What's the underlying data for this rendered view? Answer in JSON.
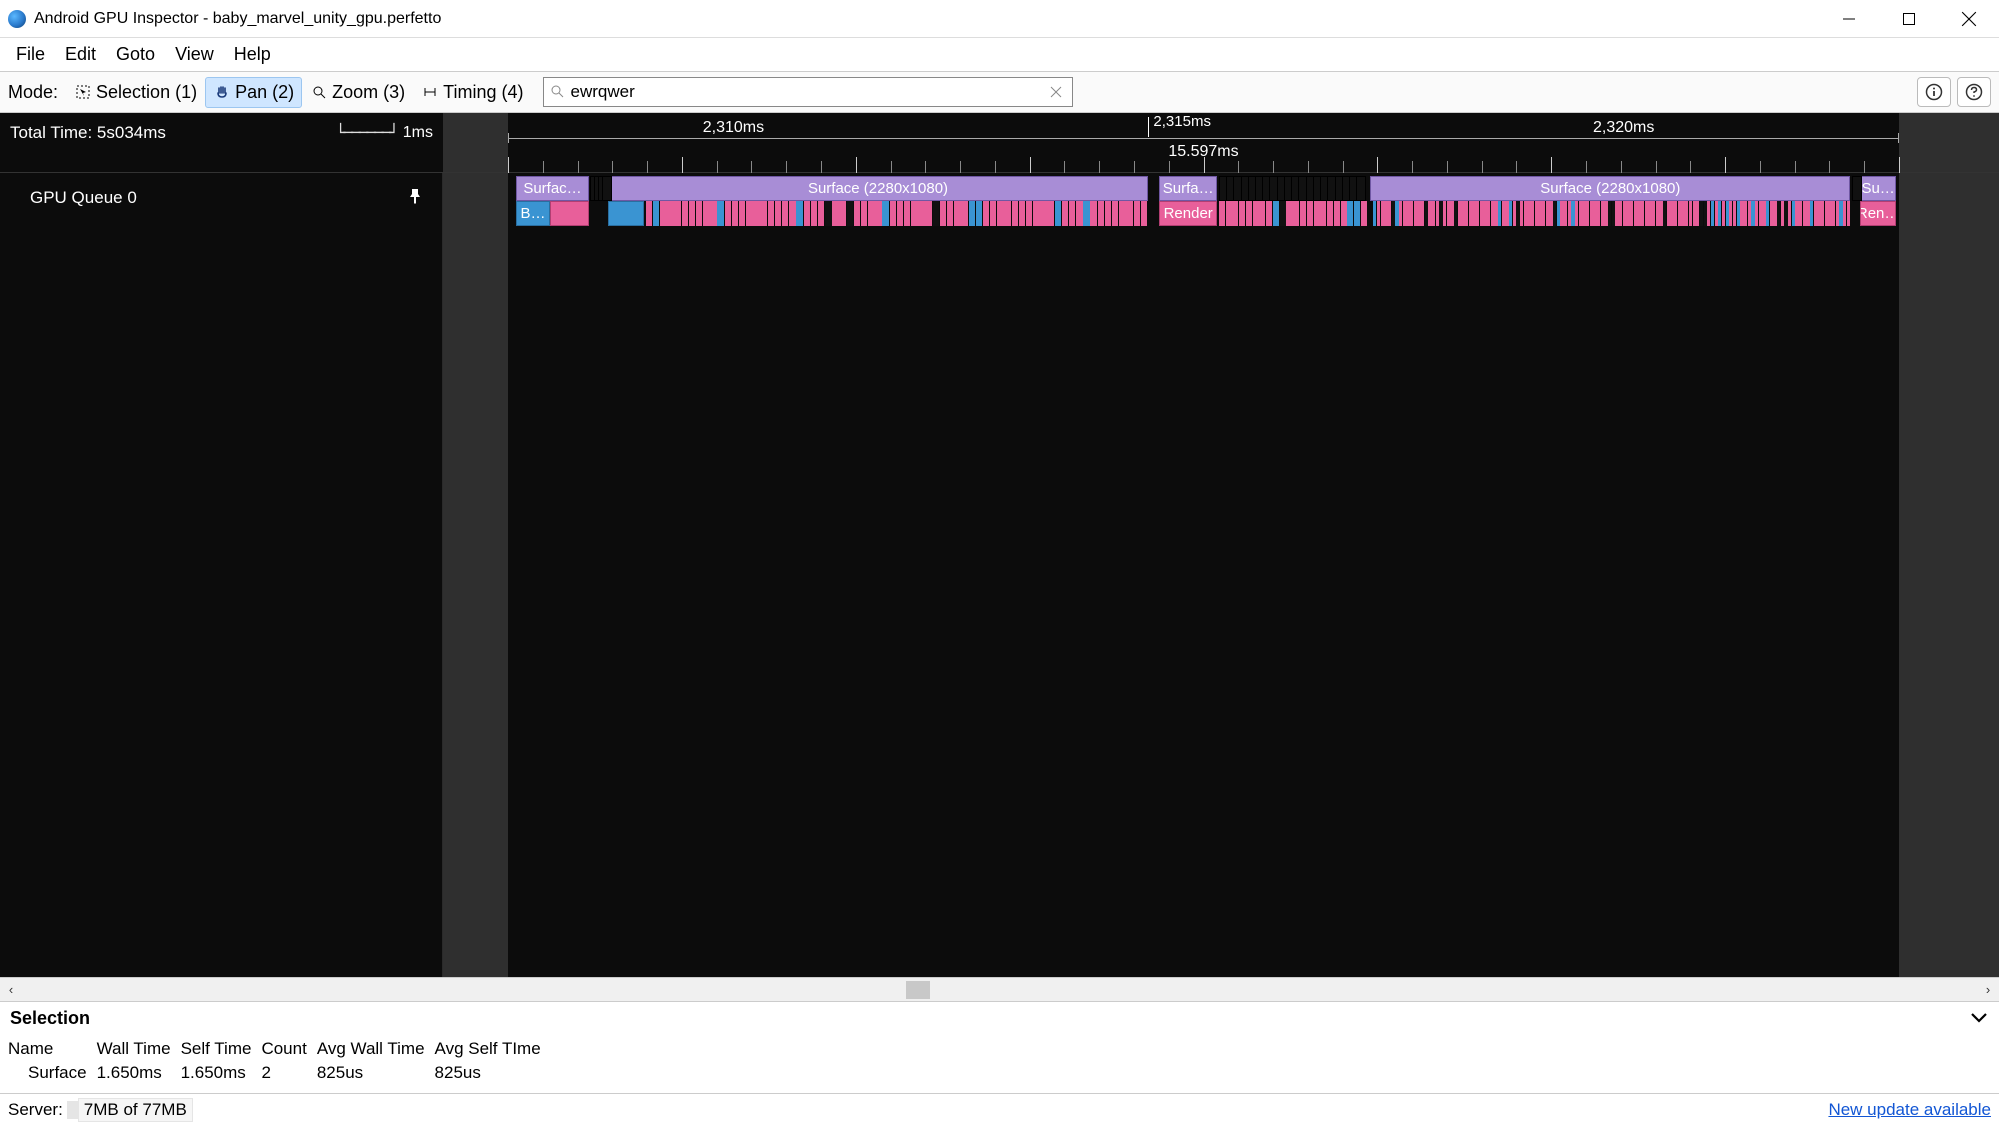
{
  "window": {
    "title": "Android GPU Inspector - baby_marvel_unity_gpu.perfetto"
  },
  "menu": {
    "items": [
      "File",
      "Edit",
      "Goto",
      "View",
      "Help"
    ]
  },
  "toolbar": {
    "mode_label": "Mode:",
    "modes": {
      "selection": "Selection (1)",
      "pan": "Pan (2)",
      "zoom": "Zoom (3)",
      "timing": "Timing (4)"
    },
    "active_mode": "pan",
    "search_value": "ewrqwer"
  },
  "timeline": {
    "total_time_label": "Total Time: 5s034ms",
    "scale_label": "1ms",
    "ruler_labels": {
      "t0": "2,310ms",
      "t1": "2,315ms",
      "t2": "2,320ms"
    },
    "range_span_label": "15.597ms"
  },
  "tracks": {
    "gpu_queue_label": "GPU Queue 0",
    "slices": {
      "surface_short": "Surfac…",
      "surface_trunc2": "Surfa…",
      "surface_tiny": "Su…",
      "surface_full": "Surface (2280x1080)",
      "b_short": "B…",
      "render": "Render",
      "render_short": "Ren…"
    }
  },
  "selection": {
    "heading": "Selection",
    "columns": [
      "Name",
      "Wall Time",
      "Self Time",
      "Count",
      "Avg Wall Time",
      "Avg Self TIme"
    ],
    "rows": [
      {
        "name": "Surface",
        "wall": "1.650ms",
        "self": "1.650ms",
        "count": "2",
        "avg_wall": "825us",
        "avg_self": "825us"
      }
    ]
  },
  "status": {
    "server_label": "Server:",
    "memory": "7MB of 77MB",
    "update_link": "New update available"
  }
}
